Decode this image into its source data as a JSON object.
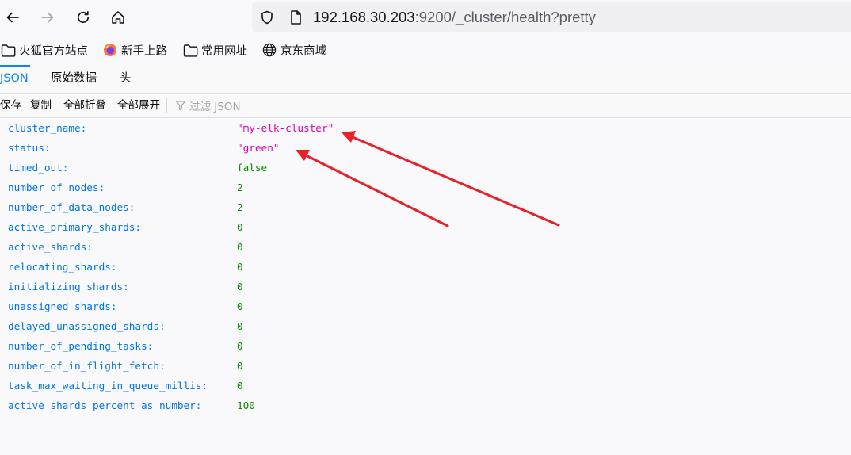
{
  "browser": {
    "url": {
      "host": "192.168.30.203",
      "path": ":9200/_cluster/health?pretty"
    }
  },
  "bookmarks": [
    {
      "label": "火狐官方站点",
      "icon": "folder-icon"
    },
    {
      "label": "新手上路",
      "icon": "firefox-icon"
    },
    {
      "label": "常用网址",
      "icon": "folder-icon"
    },
    {
      "label": "京东商城",
      "icon": "globe-icon"
    }
  ],
  "viewer": {
    "tabs": [
      "JSON",
      "原始数据",
      "头"
    ],
    "active_tab": "JSON",
    "toolbar": {
      "save": "保存",
      "copy": "复制",
      "collapse_all": "全部折叠",
      "expand_all": "全部展开",
      "filter_placeholder": "过滤 JSON"
    }
  },
  "json": {
    "rows": [
      {
        "key": "cluster_name:",
        "value": "\"my-elk-cluster\"",
        "type": "string"
      },
      {
        "key": "status:",
        "value": "\"green\"",
        "type": "string"
      },
      {
        "key": "timed_out:",
        "value": "false",
        "type": "boolean"
      },
      {
        "key": "number_of_nodes:",
        "value": "2",
        "type": "number"
      },
      {
        "key": "number_of_data_nodes:",
        "value": "2",
        "type": "number"
      },
      {
        "key": "active_primary_shards:",
        "value": "0",
        "type": "number"
      },
      {
        "key": "active_shards:",
        "value": "0",
        "type": "number"
      },
      {
        "key": "relocating_shards:",
        "value": "0",
        "type": "number"
      },
      {
        "key": "initializing_shards:",
        "value": "0",
        "type": "number"
      },
      {
        "key": "unassigned_shards:",
        "value": "0",
        "type": "number"
      },
      {
        "key": "delayed_unassigned_shards:",
        "value": "0",
        "type": "number"
      },
      {
        "key": "number_of_pending_tasks:",
        "value": "0",
        "type": "number"
      },
      {
        "key": "number_of_in_flight_fetch:",
        "value": "0",
        "type": "number"
      },
      {
        "key": "task_max_waiting_in_queue_millis:",
        "value": "0",
        "type": "number"
      },
      {
        "key": "active_shards_percent_as_number:",
        "value": "100",
        "type": "number"
      }
    ]
  },
  "colors": {
    "key": "#0074e8",
    "string": "#dd00a9",
    "number": "#058b00",
    "accent": "#0a84ff",
    "annotation_arrow": "#e8202a"
  }
}
